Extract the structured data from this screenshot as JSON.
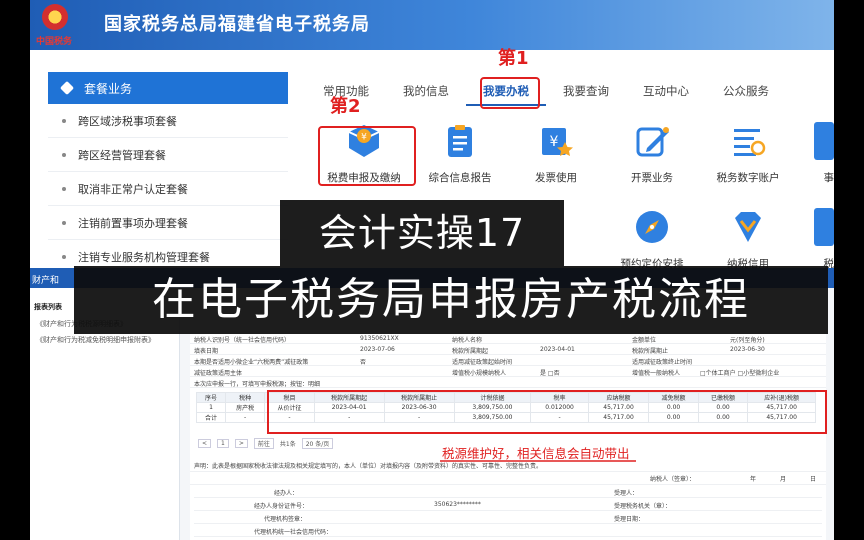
{
  "header": {
    "title": "国家税务总局福建省电子税务局",
    "logo_text": "中国税务"
  },
  "sidebar": {
    "title": "套餐业务",
    "items": [
      "跨区域涉税事项套餐",
      "跨区经营管理套餐",
      "取消非正常户认定套餐",
      "注销前置事项办理套餐",
      "注销专业服务机构管理套餐"
    ]
  },
  "nav": {
    "tabs": [
      "常用功能",
      "我的信息",
      "我要办税",
      "我要查询",
      "互动中心",
      "公众服务"
    ],
    "active_index": 2
  },
  "services": [
    {
      "label": "税费申报及缴纳",
      "icon": "tax-filing-icon"
    },
    {
      "label": "综合信息报告",
      "icon": "report-icon"
    },
    {
      "label": "发票使用",
      "icon": "invoice-icon"
    },
    {
      "label": "开票业务",
      "icon": "edit-invoice-icon"
    },
    {
      "label": "税务数字账户",
      "icon": "digital-account-icon"
    },
    {
      "label": "事",
      "icon": "more-icon"
    }
  ],
  "services_row2": [
    {
      "label": "预约定价安排",
      "icon": "compass-icon"
    },
    {
      "label": "纳税信用",
      "icon": "credit-icon"
    },
    {
      "label": "税",
      "icon": "more-icon"
    }
  ],
  "annotations": {
    "step1": "第1",
    "step2": "第2",
    "note": "税源维护好，相关信息会自动带出"
  },
  "overlay": {
    "line1": "会计实操17",
    "line2": "在电子税务局申报房产税流程"
  },
  "back_panel": {
    "bar_title": "财产和",
    "left_title": "报表列表",
    "left_items": [
      "《财产和行为税税源明细表》",
      "《财产和行为税减免税明细申报附表》"
    ],
    "info": [
      [
        "纳税人识别号（统一社会信用代码）",
        "91350621XX",
        "纳税人名称",
        "",
        "金额单位",
        "元(列至角分)"
      ],
      [
        "填表日期",
        "2023-07-06",
        "税款所属期起",
        "2023-04-01",
        "税款所属期止",
        "2023-06-30"
      ],
      [
        "本期是否适用小微企业“六税两费”减征政策",
        "否",
        "适用减征政策起始时间",
        "",
        "适用减征政策终止时间",
        ""
      ],
      [
        "减征政策适用主体",
        "",
        "增值税小规模纳税人",
        "是  □否",
        "增值税一般纳税人",
        "□个体工商户  □小型微利企业"
      ]
    ],
    "table_caption": "本次应申报一行，可填写申报税源；按钮：明细",
    "columns": [
      "序号",
      "税种",
      "税目",
      "税款所属期起",
      "税款所属期止",
      "计税依据",
      "税率",
      "应纳税额",
      "减免税额",
      "已缴税额",
      "应补(退)税额"
    ],
    "rows": [
      [
        "1",
        "房产税",
        "从价计征",
        "2023-04-01",
        "2023-06-30",
        "3,809,750.00",
        "0.012000",
        "45,717.00",
        "0.00",
        "0.00",
        "45,717.00"
      ],
      [
        "合计",
        "-",
        "-",
        "-",
        "-",
        "3,809,750.00",
        "-",
        "45,717.00",
        "0.00",
        "0.00",
        "45,717.00"
      ]
    ],
    "pager": {
      "prev": "<",
      "page": "1",
      "next": ">",
      "goto_label": "前往",
      "page_count": "共1条",
      "size": "20 条/页"
    },
    "declaration": "声明：此表是根据国家税收法律法规及相关规定填写的，本人（单位）对填报内容（及附带资料）的真实性、可靠性、完整性负责。",
    "signature": [
      "纳税人（签章）：",
      "年",
      "月",
      "日"
    ],
    "sign_rows": [
      [
        "经办人：",
        "",
        "受理人："
      ],
      [
        "经办人身份证件号：",
        "350623********",
        "受理税务机关（章）："
      ],
      [
        "代理机构签章：",
        "",
        "受理日期："
      ],
      [
        "代理机构统一社会信用代码：",
        "",
        ""
      ]
    ]
  }
}
